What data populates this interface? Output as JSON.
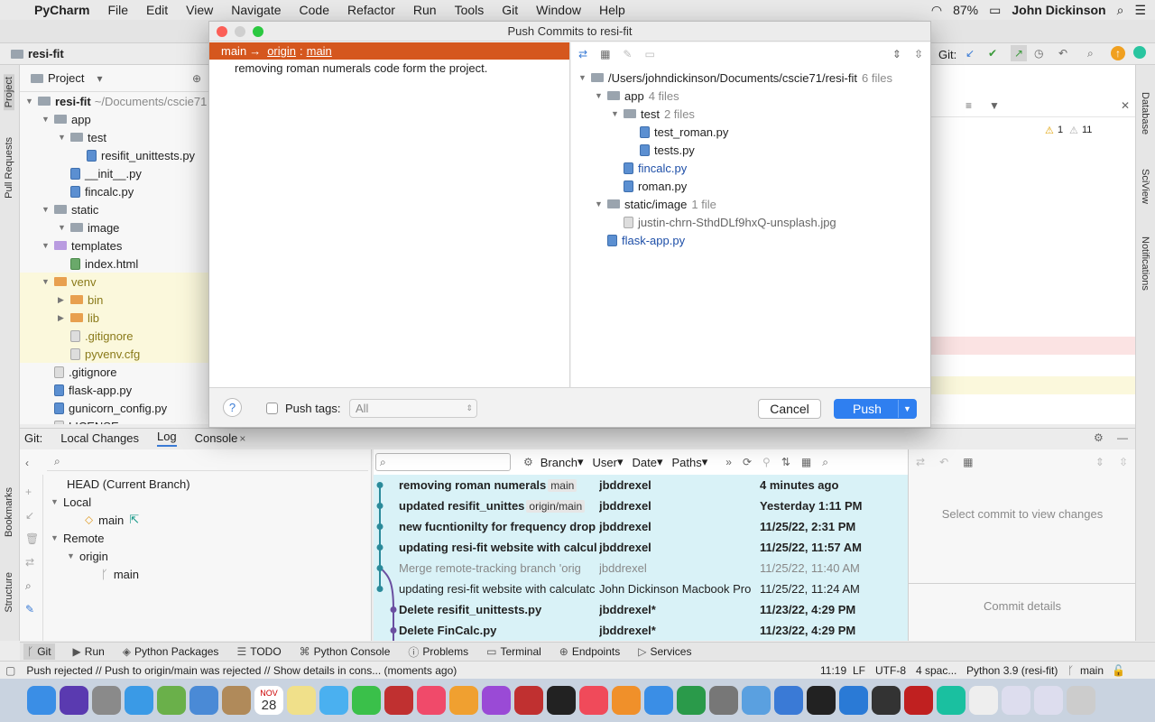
{
  "menubar": {
    "app_name": "PyCharm",
    "menus": [
      "File",
      "Edit",
      "View",
      "Navigate",
      "Code",
      "Refactor",
      "Run",
      "Tools",
      "Git",
      "Window",
      "Help"
    ],
    "battery": "87%",
    "user": "John Dickinson"
  },
  "ide": {
    "project_name": "resi-fit",
    "git_label": "Git:"
  },
  "project_panel": {
    "title": "Project",
    "root_name": "resi-fit",
    "root_path": "~/Documents/cscie71",
    "tree": [
      {
        "name": "app",
        "kind": "folder",
        "depth": 1,
        "open": true
      },
      {
        "name": "test",
        "kind": "folder",
        "depth": 2,
        "open": true
      },
      {
        "name": "resifit_unittests.py",
        "kind": "py",
        "depth": 3
      },
      {
        "name": "__init__.py",
        "kind": "py",
        "depth": 2
      },
      {
        "name": "fincalc.py",
        "kind": "py",
        "depth": 2
      },
      {
        "name": "static",
        "kind": "folder",
        "depth": 1,
        "open": true
      },
      {
        "name": "image",
        "kind": "folder",
        "depth": 2,
        "open": true
      },
      {
        "name": "templates",
        "kind": "folder-purple",
        "depth": 1,
        "open": true
      },
      {
        "name": "index.html",
        "kind": "html",
        "depth": 2
      },
      {
        "name": "venv",
        "kind": "folder-orange",
        "depth": 1,
        "open": true,
        "hl": true
      },
      {
        "name": "bin",
        "kind": "folder-orange",
        "depth": 2,
        "open": false,
        "hl": true
      },
      {
        "name": "lib",
        "kind": "folder-orange",
        "depth": 2,
        "open": false,
        "hl": true
      },
      {
        "name": ".gitignore",
        "kind": "txt",
        "depth": 2,
        "hl": true
      },
      {
        "name": "pyvenv.cfg",
        "kind": "txt",
        "depth": 2,
        "hl": true
      },
      {
        "name": ".gitignore",
        "kind": "txt",
        "depth": 1
      },
      {
        "name": "flask-app.py",
        "kind": "py",
        "depth": 1
      },
      {
        "name": "gunicorn_config.py",
        "kind": "py",
        "depth": 1
      },
      {
        "name": "LICENSE",
        "kind": "txt",
        "depth": 1
      }
    ]
  },
  "left_stripe": {
    "project": "Project",
    "pull_requests": "Pull Requests",
    "bookmarks": "Bookmarks",
    "structure": "Structure"
  },
  "right_stripe": {
    "database": "Database",
    "sciview": "SciView",
    "notifications": "Notifications"
  },
  "editor": {
    "warn_count": "1",
    "weak_warn_count": "11"
  },
  "dialog": {
    "title": "Push Commits to resi-fit",
    "branch_from": "main",
    "arrow": "→",
    "remote": "origin",
    "branch_to": "main",
    "commit_message": "removing roman numerals code form the project.",
    "tree": [
      {
        "name": "/Users/johndickinson/Documents/cscie71/resi-fit",
        "count": "6 files",
        "depth": 0,
        "kind": "folder",
        "open": true
      },
      {
        "name": "app",
        "count": "4 files",
        "depth": 1,
        "kind": "folder",
        "open": true
      },
      {
        "name": "test",
        "count": "2 files",
        "depth": 2,
        "kind": "folder",
        "open": true
      },
      {
        "name": "test_roman.py",
        "count": "",
        "depth": 3,
        "kind": "py"
      },
      {
        "name": "tests.py",
        "count": "",
        "depth": 3,
        "kind": "py"
      },
      {
        "name": "fincalc.py",
        "count": "",
        "depth": 2,
        "kind": "py",
        "color": "blue"
      },
      {
        "name": "roman.py",
        "count": "",
        "depth": 2,
        "kind": "py"
      },
      {
        "name": "static/image",
        "count": "1 file",
        "depth": 1,
        "kind": "folder",
        "open": true
      },
      {
        "name": "justin-chrn-SthdDLf9hxQ-unsplash.jpg",
        "count": "",
        "depth": 2,
        "kind": "txt"
      },
      {
        "name": "flask-app.py",
        "count": "",
        "depth": 1,
        "kind": "py",
        "color": "blue"
      }
    ],
    "help": "?",
    "push_tags_label": "Push tags:",
    "push_tags_value": "All",
    "cancel": "Cancel",
    "push": "Push"
  },
  "git_panel": {
    "tabs": [
      "Git:",
      "Local Changes",
      "Log",
      "Console"
    ],
    "branches": {
      "head": "HEAD (Current Branch)",
      "local": "Local",
      "local_main": "main",
      "remote": "Remote",
      "origin": "origin",
      "origin_main": "main"
    },
    "filters": [
      "Branch",
      "User",
      "Date",
      "Paths"
    ],
    "commits": [
      {
        "msg": "removing roman numerals",
        "tag": "main",
        "author": "jbddrexel",
        "date": "4 minutes ago",
        "style": "b"
      },
      {
        "msg": "updated resifit_unittes",
        "tag": "origin/main",
        "author": "jbddrexel",
        "date": "Yesterday 1:11 PM",
        "style": "b"
      },
      {
        "msg": "new fucntionilty for frequency drop",
        "tag": "",
        "author": "jbddrexel",
        "date": "11/25/22, 2:31 PM",
        "style": "b"
      },
      {
        "msg": "updating resi-fit website with calcul",
        "tag": "",
        "author": "jbddrexel",
        "date": "11/25/22, 11:57 AM",
        "style": "b"
      },
      {
        "msg": "Merge remote-tracking branch 'orig",
        "tag": "",
        "author": "jbddrexel",
        "date": "11/25/22, 11:40 AM",
        "style": "g"
      },
      {
        "msg": "updating resi-fit website with calculatc",
        "tag": "",
        "author": "John Dickinson Macbook Pro",
        "date": "11/25/22, 11:24 AM",
        "style": "n"
      },
      {
        "msg": "Delete resifit_unittests.py",
        "tag": "",
        "author": "jbddrexel*",
        "date": "11/23/22, 4:29 PM",
        "style": "b"
      },
      {
        "msg": "Delete FinCalc.py",
        "tag": "",
        "author": "jbddrexel*",
        "date": "11/23/22, 4:29 PM",
        "style": "b"
      }
    ],
    "select_commit": "Select commit to view changes",
    "commit_details": "Commit details"
  },
  "toolstripe": [
    "Git",
    "Run",
    "Python Packages",
    "TODO",
    "Python Console",
    "Problems",
    "Terminal",
    "Endpoints",
    "Services"
  ],
  "statusbar": {
    "message": "Push rejected // Push to origin/main was rejected // Show details in cons... (moments ago)",
    "time": "11:19",
    "lf": "LF",
    "encoding": "UTF-8",
    "indent": "4 spac...",
    "interpreter": "Python 3.9 (resi-fit)",
    "branch": "main"
  },
  "dock": {
    "calendar_day": "28",
    "calendar_month": "NOV"
  }
}
